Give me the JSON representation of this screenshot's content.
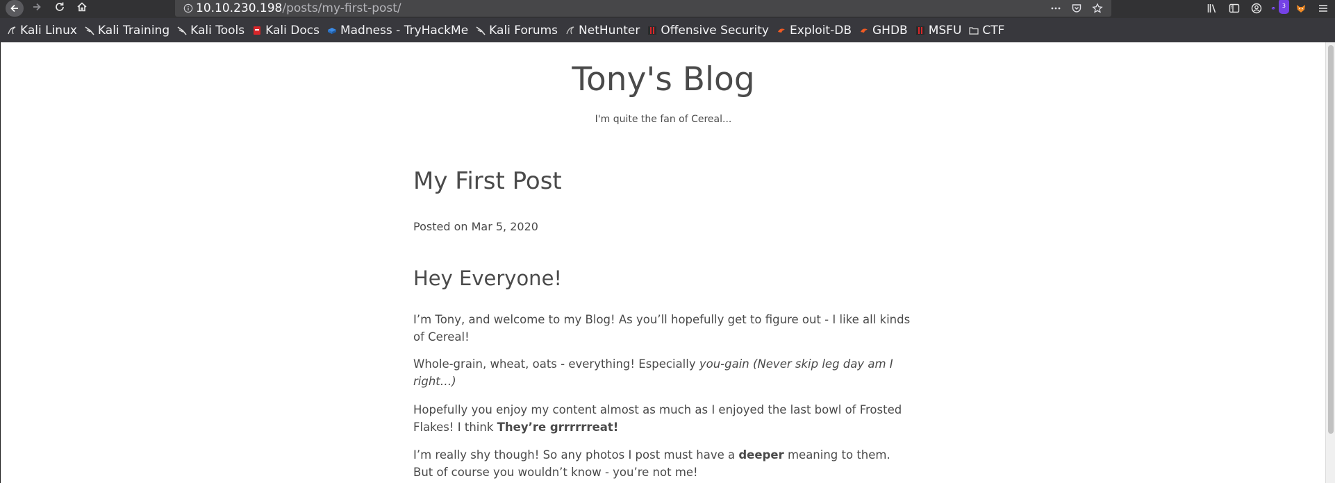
{
  "browser": {
    "url_host": "10.10.230.198",
    "url_path": "/posts/my-first-post/",
    "extensions_badge": "3"
  },
  "bookmarks": [
    {
      "label": "Kali Linux",
      "icon": "kali-dragon-icon"
    },
    {
      "label": "Kali Training",
      "icon": "kali-dragon-icon"
    },
    {
      "label": "Kali Tools",
      "icon": "kali-dragon-icon"
    },
    {
      "label": "Kali Docs",
      "icon": "kali-docs-icon"
    },
    {
      "label": "Madness - TryHackMe",
      "icon": "tryhackme-icon"
    },
    {
      "label": "Kali Forums",
      "icon": "kali-dragon-icon"
    },
    {
      "label": "NetHunter",
      "icon": "nethunter-icon"
    },
    {
      "label": "Offensive Security",
      "icon": "offsec-icon"
    },
    {
      "label": "Exploit-DB",
      "icon": "exploitdb-icon"
    },
    {
      "label": "GHDB",
      "icon": "exploitdb-icon"
    },
    {
      "label": "MSFU",
      "icon": "offsec-icon"
    },
    {
      "label": "CTF",
      "icon": "folder-icon"
    }
  ],
  "site": {
    "title": "Tony's Blog",
    "subtitle": "I'm quite the fan of Cereal..."
  },
  "post": {
    "title": "My First Post",
    "date": "Posted on Mar 5, 2020",
    "heading": "Hey Everyone!",
    "p1": "I’m Tony, and welcome to my Blog! As you’ll hopefully get to figure out - I like all kinds of Cereal!",
    "p2_a": "Whole-grain, wheat, oats - everything! Especially ",
    "p2_em": "you-gain (Never skip leg day am I right…)",
    "p3_a": "Hopefully you enjoy my content almost as much as I enjoyed the last bowl of Frosted Flakes! I think ",
    "p3_strong": "They’re grrrrrreat!",
    "p4_a": "I’m really shy though! So any photos I post must have a ",
    "p4_strong": "deeper",
    "p4_b": " meaning to them. But of course you wouldn’t know - you’re not me!"
  },
  "colors": {
    "toolbar": "#323234",
    "bookmarks_bar": "#38383d",
    "text": "#4a4a4a"
  }
}
